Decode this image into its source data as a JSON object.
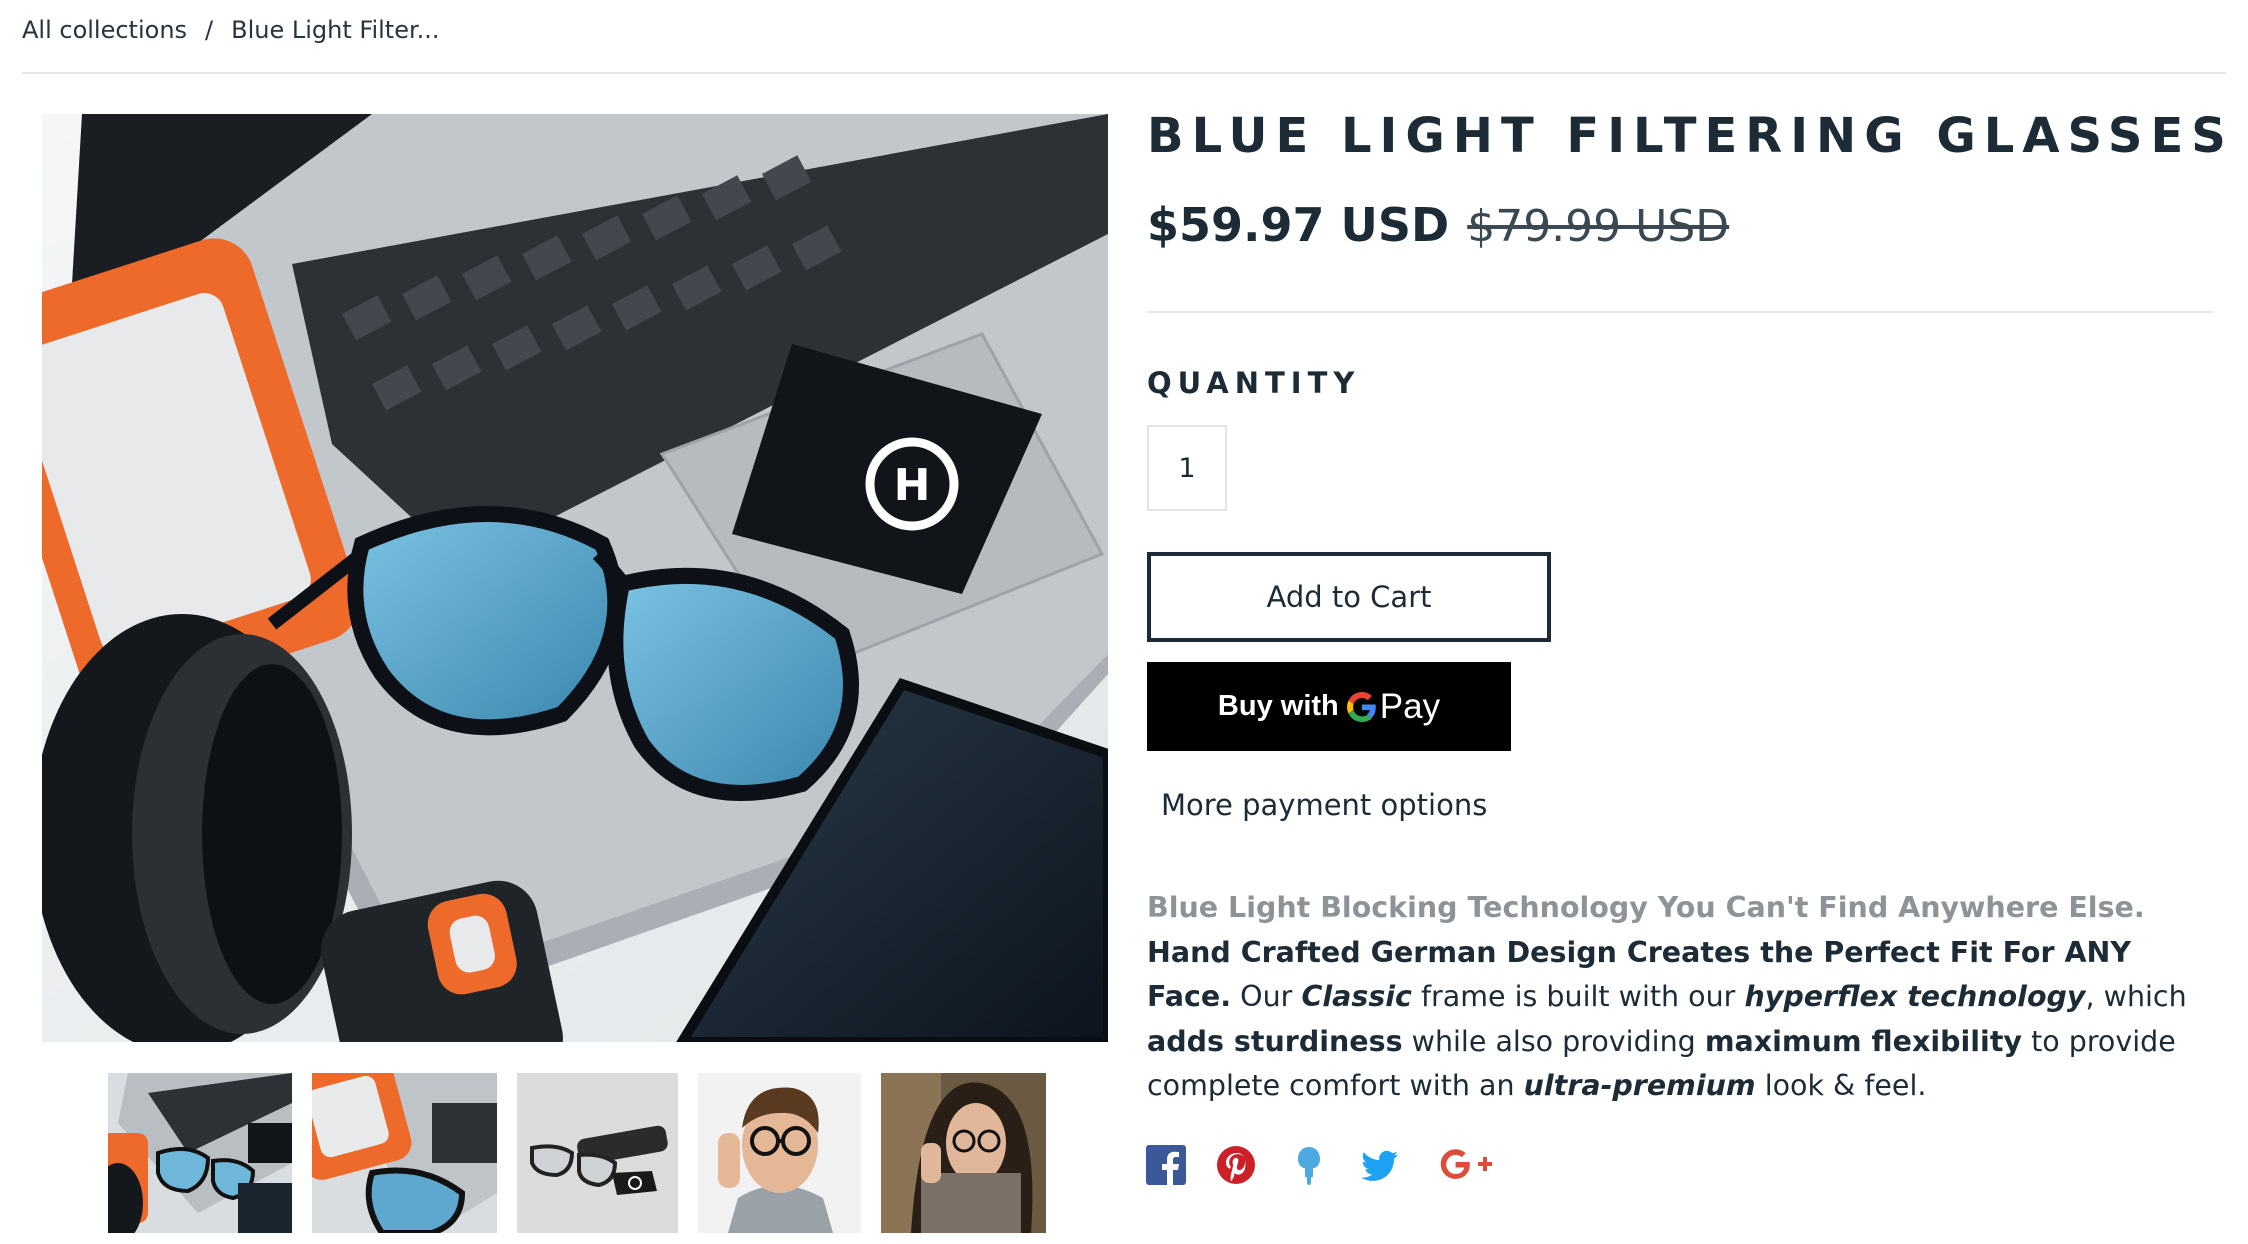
{
  "breadcrumb": {
    "root": "All collections",
    "separator": "/",
    "current": "Blue Light Filter..."
  },
  "product": {
    "title": "BLUE LIGHT FILTERING GLASSES",
    "price": "$59.97 USD",
    "compare_price": "$79.99 USD",
    "quantity_label": "QUANTITY",
    "quantity_value": "1",
    "add_to_cart": "Add to Cart",
    "gpay": {
      "buy_with": "Buy with",
      "pay": "Pay"
    },
    "more_payment": "More payment options"
  },
  "description": {
    "muted_lead": "Blue Light Blocking Technology You Can't Find Anywhere Else.",
    "bold_lead": "Hand Crafted German Design Creates the Perfect Fit For ANY Face.",
    "t1": "Our",
    "classic": "Classic",
    "t2": "frame is built with our",
    "hyperflex": "hyperflex technology",
    "t3": ", which",
    "adds_sturdiness": "adds sturdiness",
    "t4": "while also providing",
    "max_flex": "maximum flexibility",
    "t5": "to provide complete comfort with an",
    "ultra": "ultra-premium",
    "t6": "look & feel."
  },
  "social": [
    "facebook-icon",
    "pinterest-icon",
    "fancy-icon",
    "twitter-icon",
    "google-plus-icon"
  ],
  "colors": {
    "text": "#1c2b36",
    "muted": "#8e9398",
    "facebook": "#3b5998",
    "pinterest": "#cb2027",
    "fancy": "#4ea9e1",
    "twitter": "#1da1f2",
    "google_plus": "#dd4b39"
  }
}
